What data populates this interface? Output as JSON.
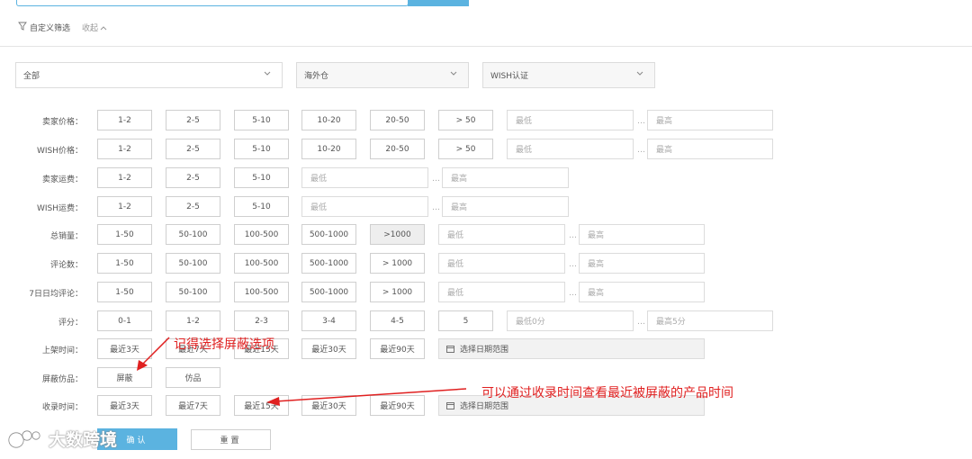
{
  "filter_toggle": {
    "label": "自定义筛选",
    "collapse_label": "收起"
  },
  "dropdowns": [
    {
      "value": "全部"
    },
    {
      "value": "海外仓"
    },
    {
      "value": "WISH认证"
    }
  ],
  "rows": [
    {
      "label": "卖家价格：",
      "options": [
        "1-2",
        "2-5",
        "5-10",
        "10-20",
        "20-50",
        "> 50"
      ],
      "min_placeholder": "最低",
      "max_placeholder": "最高"
    },
    {
      "label": "WISH价格：",
      "options": [
        "1-2",
        "2-5",
        "5-10",
        "10-20",
        "20-50",
        "> 50"
      ],
      "min_placeholder": "最低",
      "max_placeholder": "最高"
    },
    {
      "label": "卖家运费：",
      "options": [
        "1-2",
        "2-5",
        "5-10"
      ],
      "min_placeholder": "最低",
      "max_placeholder": "最高"
    },
    {
      "label": "WISH运费：",
      "options": [
        "1-2",
        "2-5",
        "5-10"
      ],
      "min_placeholder": "最低",
      "max_placeholder": "最高"
    },
    {
      "label": "总销量：",
      "options": [
        "1-50",
        "50-100",
        "100-500",
        "500-1000",
        ">1000"
      ],
      "min_placeholder": "最低",
      "max_placeholder": "最高",
      "selected": ">1000"
    },
    {
      "label": "评论数：",
      "options": [
        "1-50",
        "50-100",
        "100-500",
        "500-1000",
        "> 1000"
      ],
      "min_placeholder": "最低",
      "max_placeholder": "最高"
    },
    {
      "label": "7日日均评论：",
      "options": [
        "1-50",
        "50-100",
        "100-500",
        "500-1000",
        "> 1000"
      ],
      "min_placeholder": "最低",
      "max_placeholder": "最高"
    },
    {
      "label": "评分：",
      "options": [
        "0-1",
        "1-2",
        "2-3",
        "3-4",
        "4-5",
        "5"
      ],
      "min_placeholder": "最低0分",
      "max_placeholder": "最高5分"
    },
    {
      "label": "上架时间：",
      "options": [
        "最近3天",
        "最近7天",
        "最近15天",
        "最近30天",
        "最近90天"
      ],
      "date_range": "选择日期范围"
    },
    {
      "label": "屏蔽仿品：",
      "options": [
        "屏蔽",
        "仿品"
      ]
    },
    {
      "label": "收录时间：",
      "options": [
        "最近3天",
        "最近7天",
        "最近15天",
        "最近30天",
        "最近90天"
      ],
      "date_range": "选择日期范围"
    }
  ],
  "actions": {
    "confirm": "确认",
    "reset": "重置"
  },
  "annotations": {
    "note1": "记得选择屏蔽选项",
    "note2": "可以通过收录时间查看最近被屏蔽的产品时间",
    "color": "#e02020"
  },
  "watermark": "大数跨境",
  "colors": {
    "accent": "#5bb3e0",
    "annotation": "#e02020"
  }
}
